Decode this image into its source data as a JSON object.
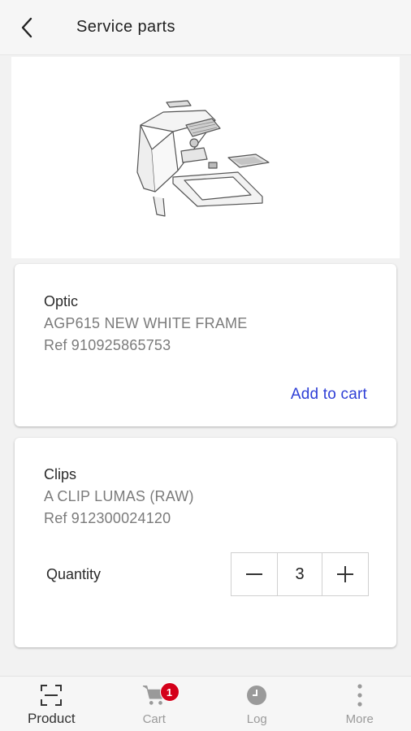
{
  "header": {
    "title": "Service parts"
  },
  "parts": [
    {
      "category": "Optic",
      "name": "AGP615 NEW WHITE FRAME",
      "ref": "Ref 910925865753",
      "action_label": "Add to cart"
    },
    {
      "category": "Clips",
      "name": "A CLIP LUMAS (RAW)",
      "ref": "Ref 912300024120",
      "quantity_label": "Quantity",
      "quantity": "3"
    }
  ],
  "bottom_nav": {
    "items": [
      {
        "label": "Product",
        "icon": "scan-icon",
        "active": true
      },
      {
        "label": "Cart",
        "icon": "cart-icon",
        "badge": "1"
      },
      {
        "label": "Log",
        "icon": "clock-icon"
      },
      {
        "label": "More",
        "icon": "more-vertical-icon"
      }
    ]
  },
  "colors": {
    "accent_link": "#2f3fd6",
    "badge": "#d4001a"
  }
}
